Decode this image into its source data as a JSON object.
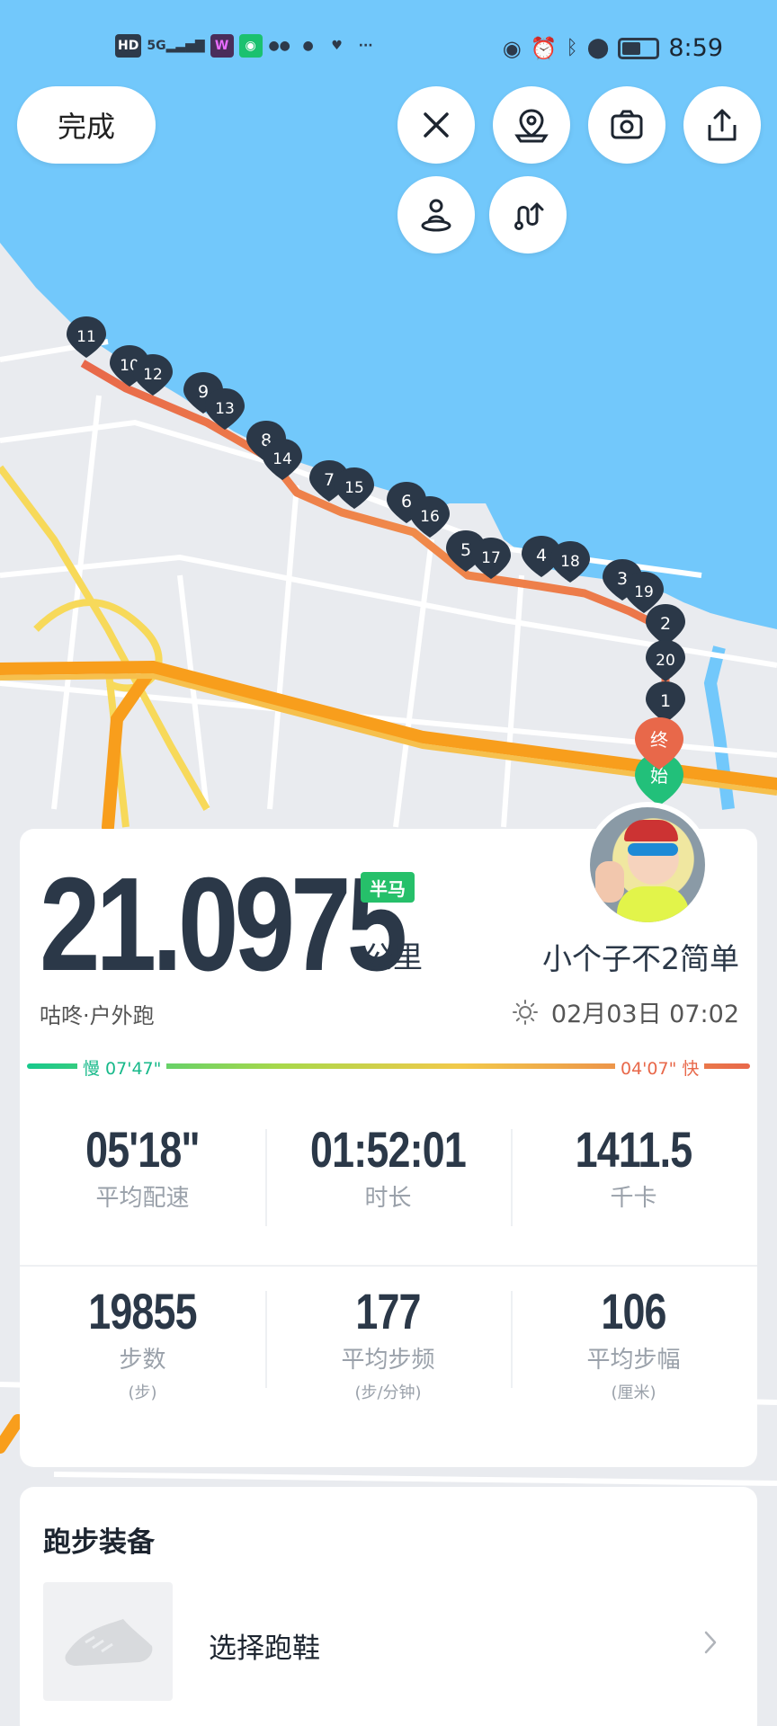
{
  "status_bar": {
    "left_icons": [
      "HD",
      "5G",
      "signal-icon",
      "W",
      "app-icon",
      "wechat-icon",
      "message-icon",
      "health-icon",
      "..."
    ],
    "time": "8:59"
  },
  "toolbar": {
    "done_label": "完成",
    "buttons": [
      "close-icon",
      "location-icon",
      "camera-icon",
      "share-icon",
      "person-icon",
      "route-icon"
    ]
  },
  "map": {
    "km_markers": [
      "11",
      "10",
      "12",
      "9",
      "13",
      "8",
      "14",
      "7",
      "15",
      "6",
      "16",
      "5",
      "17",
      "4",
      "18",
      "3",
      "19",
      "2",
      "20",
      "1"
    ],
    "end_label": "终",
    "start_label": "始",
    "colors": {
      "water": "#72c8fb",
      "land": "#e9ebef",
      "route_slow": "#f5a04a",
      "route_fast": "#e8684a",
      "highway": "#f89e1c"
    }
  },
  "summary": {
    "distance": "21.0975",
    "badge": "半马",
    "unit": "公里",
    "username": "小个子不2简单",
    "sport": "咕咚·户外跑",
    "date": "02月03日 07:02",
    "pace_slow": "慢 07'47\"",
    "pace_fast": "04'07\" 快",
    "stats_row1": [
      {
        "value": "05'18\"",
        "label": "平均配速"
      },
      {
        "value": "01:52:01",
        "label": "时长"
      },
      {
        "value": "1411.5",
        "label": "千卡"
      }
    ],
    "stats_row2": [
      {
        "value": "19855",
        "label": "步数",
        "sub": "(步)"
      },
      {
        "value": "177",
        "label": "平均步频",
        "sub": "(步/分钟)"
      },
      {
        "value": "106",
        "label": "平均步幅",
        "sub": "(厘米)"
      }
    ]
  },
  "equipment": {
    "title": "跑步装备",
    "shoe_label": "选择跑鞋"
  }
}
